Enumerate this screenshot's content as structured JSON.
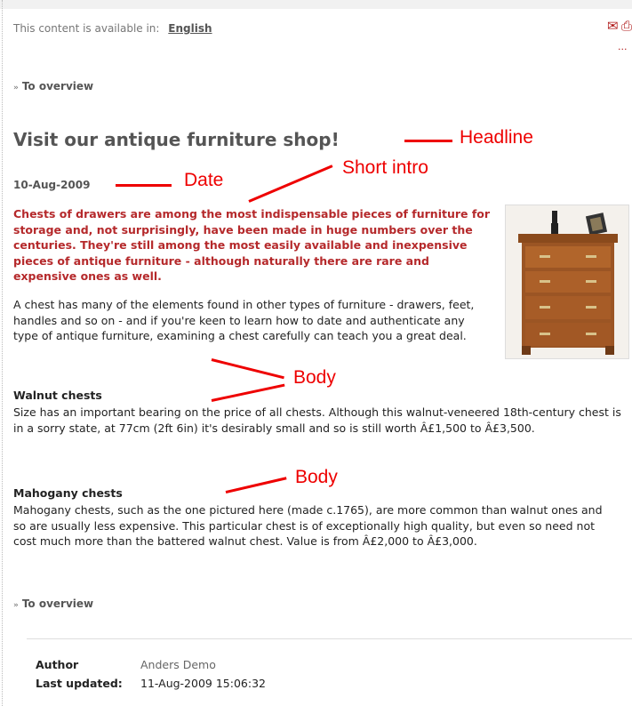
{
  "header": {
    "availability_text": "This content is available in:",
    "language_link": "English",
    "corner_text": "..."
  },
  "nav": {
    "overview_top": "To overview",
    "overview_bottom": "To overview"
  },
  "article": {
    "headline": "Visit our antique furniture shop!",
    "date": "10-Aug-2009",
    "intro": "Chests of drawers are among the most indispensable pieces of furniture for storage and, not surprisingly, have been made in huge numbers over the centuries. They're still among the most easily available and inexpensive pieces of antique furniture - although naturally there are rare and expensive ones as well.",
    "body_paragraph": "A chest has many of the elements found in other types of furniture - drawers, feet, handles and so on - and if you're keen to learn how to date and authenticate any type of antique furniture, examining a chest carefully can teach you a great deal.",
    "sections": [
      {
        "title": "Walnut chests",
        "text": "Size has an important bearing on the price of all chests. Although this walnut-veneered 18th-century chest is in a sorry state, at 77cm (2ft 6in) it's desirably small and so is still worth Â£1,500 to Â£3,500."
      },
      {
        "title": "Mahogany chests",
        "text": "Mahogany chests, such as the one pictured here (made c.1765), are more common than walnut ones and so are usually less expensive. This particular chest is of exceptionally high quality, but even so need not cost much more than the battered walnut chest. Value is from Â£2,000 to Â£3,000."
      }
    ]
  },
  "meta": {
    "author_label": "Author",
    "author_value": "Anders Demo",
    "updated_label": "Last updated:",
    "updated_value": "11-Aug-2009 15:06:32"
  },
  "annotations": {
    "headline": "Headline",
    "date": "Date",
    "short_intro": "Short intro",
    "body_1": "Body",
    "body_2": "Body"
  },
  "icons": {
    "email": "email-icon",
    "print": "print-icon",
    "overview_chevron": "double-chevron-right-icon"
  },
  "colors": {
    "intro_red": "#b5292b",
    "annotation_red": "#e00000",
    "icon_red": "#b01c1c"
  }
}
